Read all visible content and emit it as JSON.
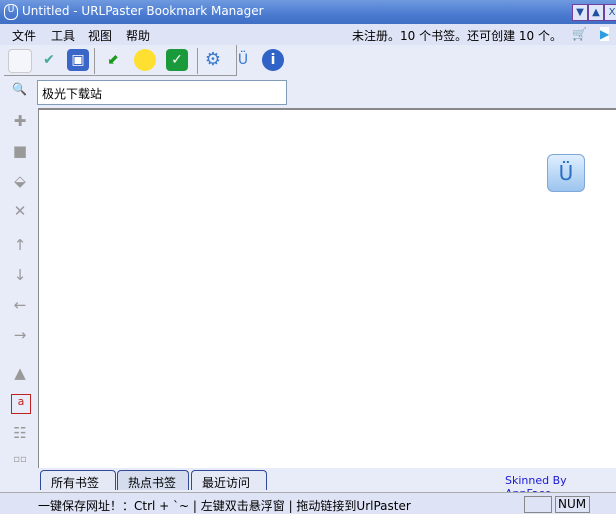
{
  "window": {
    "title": "Untitled - URLPaster Bookmark Manager",
    "logo": "U"
  },
  "menu": {
    "items": [
      "文件",
      "工具",
      "视图",
      "帮助"
    ],
    "status": "未注册。10 个书签。还可创建 10 个。"
  },
  "search": {
    "value": "极光下载站"
  },
  "tabs": [
    "所有书签",
    "热点书签",
    "最近访问"
  ],
  "skin": "Skinned By AppFace",
  "statusbar": {
    "text": "一键保存网址！：Ctrl + `~  | 左键双击悬浮窗 | 拖动链接到UrlPaster",
    "num": "NUM"
  }
}
